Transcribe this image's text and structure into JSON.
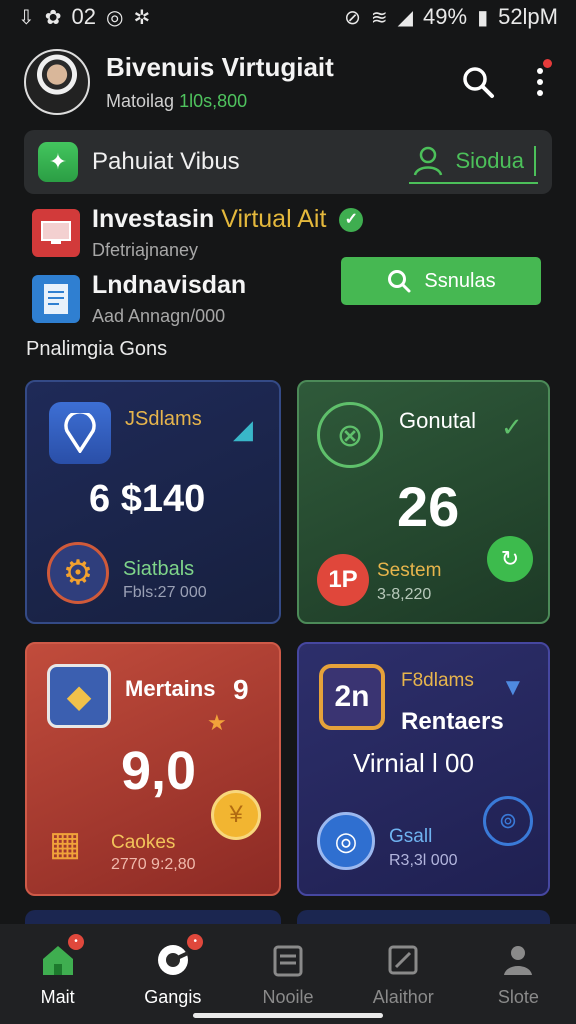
{
  "status": {
    "left_time": "02",
    "battery": "49%",
    "clock": "52lpM"
  },
  "header": {
    "title": "Bivenuis Virtugiait",
    "subtitle_prefix": "Matoilag",
    "subtitle_value": "1l0s,800"
  },
  "banner": {
    "label": "Pahuiat Vibus",
    "button": "Siodua"
  },
  "list": [
    {
      "title": "Investasin",
      "title_accent": "Virtual Ait",
      "subtitle": "Dfetriajnaney"
    },
    {
      "title": "Lndnavisdan",
      "subtitle": "Aad Annagn/000"
    }
  ],
  "action_button": "Ssnulas",
  "section_title": "Pnalimgia Gons",
  "cards": [
    {
      "label": "JSdlams",
      "value": "6 $140",
      "title": "Siatbals",
      "subtitle": "Fbls:27 000"
    },
    {
      "label": "Gonutal",
      "value": "26",
      "badge": "1P",
      "title": "Sestem",
      "subtitle": "3-8,220"
    },
    {
      "label": "Mertains",
      "label_num": "9",
      "value": "9,0",
      "title": "Caokes",
      "subtitle": "2770 9:2,80"
    },
    {
      "label": "F8dlams",
      "icon_text": "2n",
      "title": "Rentaers",
      "value": "Virnial l 00",
      "small_title": "Gsall",
      "subtitle": "R3,3l 000"
    }
  ],
  "nav": [
    {
      "label": "Mait",
      "active": true
    },
    {
      "label": "Gangis",
      "active": false
    },
    {
      "label": "Nooile",
      "active": false
    },
    {
      "label": "Alaithor",
      "active": false
    },
    {
      "label": "Slote",
      "active": false
    }
  ],
  "colors": {
    "background": "#151617",
    "accent_green": "#46b852",
    "accent_yellow": "#e4b83c",
    "badge_red": "#e0483c"
  }
}
